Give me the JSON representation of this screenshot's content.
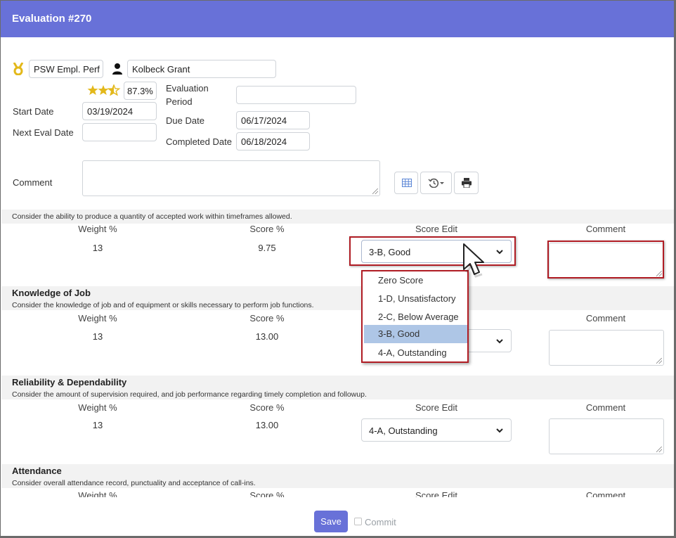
{
  "window": {
    "title": "Evaluation #270"
  },
  "header": {
    "template": "PSW Empl. Perf",
    "employee": "Kolbeck Grant",
    "score_percent": "87.3%",
    "rating_stars": 2.5
  },
  "fields": {
    "start_date_label": "Start Date",
    "start_date": "03/19/2024",
    "next_eval_date_label": "Next Eval Date",
    "next_eval_date": "",
    "evaluation_period_label_1": "Evaluation",
    "evaluation_period_label_2": "Period",
    "evaluation_period": "",
    "due_date_label": "Due Date",
    "due_date": "06/17/2024",
    "completed_date_label": "Completed Date",
    "completed_date": "06/18/2024",
    "comment_label": "Comment",
    "comment": ""
  },
  "toolbar": {
    "icons": [
      "grid-icon",
      "history-icon",
      "print-icon"
    ]
  },
  "columns": {
    "weight": "Weight %",
    "score": "Score %",
    "score_edit": "Score Edit",
    "comment": "Comment"
  },
  "sections": [
    {
      "title": "",
      "description": "Consider the ability to produce a quantity of accepted work within timeframes allowed.",
      "weight": "13",
      "score": "9.75",
      "score_edit": "3-B, Good"
    },
    {
      "title": "Knowledge of Job",
      "description": "Consider the knowledge of job and of equipment or skills necessary to perform job functions.",
      "weight": "13",
      "score": "13.00",
      "score_edit": ""
    },
    {
      "title": "Reliability & Dependability",
      "description": "Consider the amount of supervision required, and job performance regarding timely completion and followup.",
      "weight": "13",
      "score": "13.00",
      "score_edit": "4-A, Outstanding"
    },
    {
      "title": "Attendance",
      "description": "Consider overall attendance record, punctuality and acceptance of call-ins.",
      "weight": "",
      "score": "",
      "score_edit": ""
    }
  ],
  "dropdown": {
    "options": [
      "Zero Score",
      "1-D, Unsatisfactory",
      "2-C, Below Average",
      "3-B, Good",
      "4-A, Outstanding"
    ],
    "selected": "3-B, Good"
  },
  "footer": {
    "save_label": "Save",
    "commit_label": "Commit"
  },
  "colors": {
    "accent": "#6871d8",
    "highlight": "#b01c24",
    "selected_option": "#aec6e6"
  }
}
